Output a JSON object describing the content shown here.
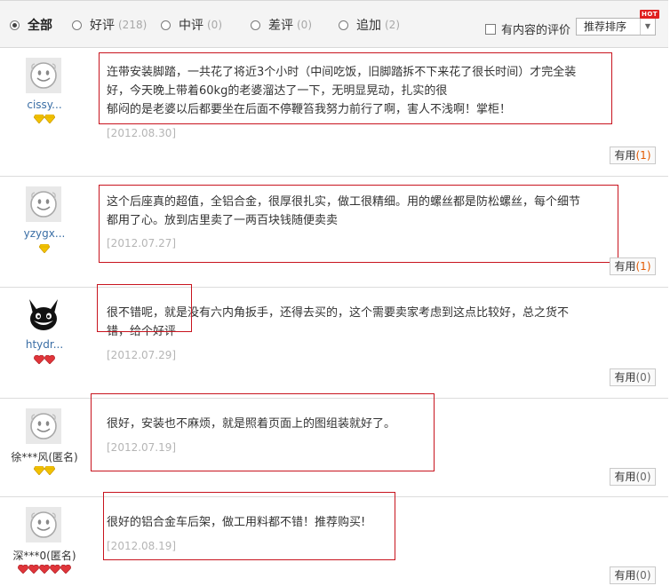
{
  "filter": {
    "options": [
      {
        "label": "全部",
        "count": ""
      },
      {
        "label": "好评",
        "count": "(218)"
      },
      {
        "label": "中评",
        "count": "(0)"
      },
      {
        "label": "差评",
        "count": "(0)"
      },
      {
        "label": "追加",
        "count": "(2)"
      }
    ],
    "selected_index": 0,
    "has_content_label": "有内容的评价",
    "sort_label": "推荐排序",
    "hot_badge": "HOT"
  },
  "colors": {
    "highlight": "#c8141e",
    "username": "#3a6ea5",
    "useful_count": "#e35a00",
    "gold_rank": "#f2c200",
    "red_rank": "#e0353a"
  },
  "reviews": [
    {
      "user": "cissy...",
      "rank_icon": "gold-diamond-icon",
      "rank_count": 2,
      "content": [
        "迕带安装脚踏，一共花了将近3个小时（中间吃饭，旧脚踏拆不下来花了很长时间）才完全装",
        "好，今天晚上带着60kg的老婆溜达了一下，无明显晃动，扎实的很",
        "郁闷的是老婆以后都要坐在后面不停鞭笞我努力前行了啊，害人不浅啊！掌柜！"
      ],
      "date": "[2012.08.30]",
      "useful_label": "有用",
      "useful_count": "(1)"
    },
    {
      "user": "yzygx...",
      "rank_icon": "gold-diamond-icon",
      "rank_count": 1,
      "content": [
        "这个后座真的超值，全铝合金，很厚很扎实，做工很精细。用的螺丝都是防松螺丝，每个细节",
        "都用了心。放到店里卖了一两百块钱随便卖卖"
      ],
      "date": "[2012.07.27]",
      "useful_label": "有用",
      "useful_count": "(1)"
    },
    {
      "user": "htydr...",
      "rank_icon": "red-heart-icon",
      "rank_count": 2,
      "content": [
        "很不错呢，就是没有六内角扳手，还得去买的，这个需要卖家考虑到这点比较好，总之货不",
        "错，给个好评"
      ],
      "date": "[2012.07.29]",
      "useful_label": "有用",
      "useful_count": "(0)"
    },
    {
      "user": "徐***风(匿名)",
      "rank_icon": "gold-diamond-icon",
      "rank_count": 2,
      "content": [
        "很好，安装也不麻烦，就是照着页面上的图组装就好了。"
      ],
      "date": "[2012.07.19]",
      "useful_label": "有用",
      "useful_count": "(0)"
    },
    {
      "user": "深***0(匿名)",
      "rank_icon": "red-heart-icon",
      "rank_count": 5,
      "content": [
        "很好的铝合金车后架，做工用料都不错！推荐购买!"
      ],
      "date": "[2012.08.19]",
      "useful_label": "有用",
      "useful_count": "(0)"
    }
  ]
}
